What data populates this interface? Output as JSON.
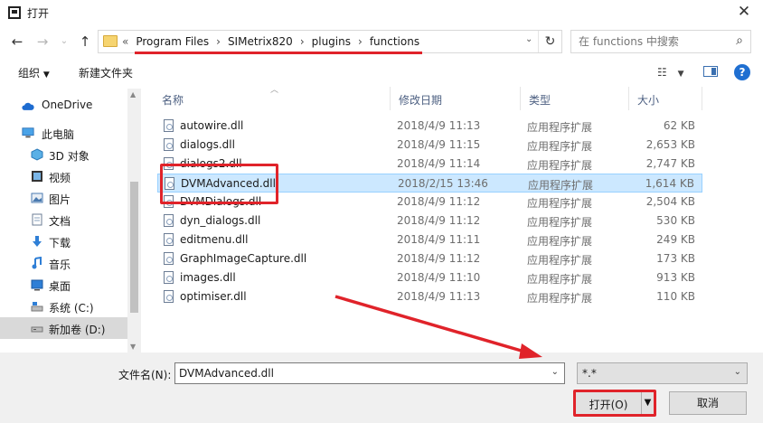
{
  "window": {
    "title": "打开"
  },
  "nav": {
    "breadcrumbs": [
      "Program Files",
      "SIMetrix820",
      "plugins",
      "functions"
    ],
    "search_placeholder": "在 functions 中搜索"
  },
  "toolbar": {
    "organize": "组织",
    "new_folder": "新建文件夹"
  },
  "sidebar": {
    "items": [
      {
        "label": "OneDrive",
        "icon": "cloud-icon"
      },
      {
        "label": "此电脑",
        "icon": "computer-icon"
      },
      {
        "label": "3D 对象",
        "icon": "3d-objects-icon"
      },
      {
        "label": "视频",
        "icon": "video-icon"
      },
      {
        "label": "图片",
        "icon": "pictures-icon"
      },
      {
        "label": "文档",
        "icon": "documents-icon"
      },
      {
        "label": "下载",
        "icon": "downloads-icon"
      },
      {
        "label": "音乐",
        "icon": "music-icon"
      },
      {
        "label": "桌面",
        "icon": "desktop-icon"
      },
      {
        "label": "系统 (C:)",
        "icon": "drive-c-icon"
      },
      {
        "label": "新加卷 (D:)",
        "icon": "drive-d-icon",
        "selected": true
      }
    ]
  },
  "columns": {
    "name": "名称",
    "date": "修改日期",
    "type": "类型",
    "size": "大小"
  },
  "files": [
    {
      "name": "autowire.dll",
      "date": "2018/4/9 11:13",
      "type": "应用程序扩展",
      "size": "62 KB"
    },
    {
      "name": "dialogs.dll",
      "date": "2018/4/9 11:15",
      "type": "应用程序扩展",
      "size": "2,653 KB"
    },
    {
      "name": "dialogs2.dll",
      "date": "2018/4/9 11:14",
      "type": "应用程序扩展",
      "size": "2,747 KB"
    },
    {
      "name": "DVMAdvanced.dll",
      "date": "2018/2/15 13:46",
      "type": "应用程序扩展",
      "size": "1,614 KB",
      "selected": true
    },
    {
      "name": "DVMDialogs.dll",
      "date": "2018/4/9 11:12",
      "type": "应用程序扩展",
      "size": "2,504 KB"
    },
    {
      "name": "dyn_dialogs.dll",
      "date": "2018/4/9 11:12",
      "type": "应用程序扩展",
      "size": "530 KB"
    },
    {
      "name": "editmenu.dll",
      "date": "2018/4/9 11:11",
      "type": "应用程序扩展",
      "size": "249 KB"
    },
    {
      "name": "GraphImageCapture.dll",
      "date": "2018/4/9 11:12",
      "type": "应用程序扩展",
      "size": "173 KB"
    },
    {
      "name": "images.dll",
      "date": "2018/4/9 11:10",
      "type": "应用程序扩展",
      "size": "913 KB"
    },
    {
      "name": "optimiser.dll",
      "date": "2018/4/9 11:13",
      "type": "应用程序扩展",
      "size": "110 KB"
    }
  ],
  "footer": {
    "filename_label": "文件名(N):",
    "filename_value": "DVMAdvanced.dll",
    "filter_value": "*.*",
    "open_label": "打开(O)",
    "cancel_label": "取消"
  },
  "colors": {
    "annotation": "#e0232a",
    "selection": "#cce8ff",
    "accent": "#1f6fd1"
  }
}
